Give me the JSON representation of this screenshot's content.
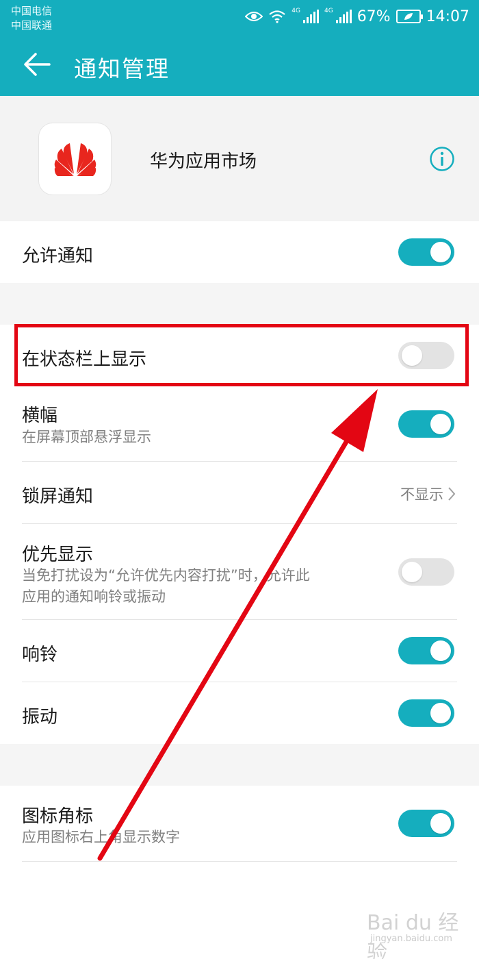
{
  "status_bar": {
    "carrier_1": "中国电信",
    "carrier_2": "中国联通",
    "network_1": "4G",
    "network_2": "4G",
    "battery_percent": "67%",
    "time": "14:07"
  },
  "header": {
    "title": "通知管理",
    "background": "#15aebe"
  },
  "app": {
    "name": "华为应用市场",
    "icon": "huawei-logo-icon"
  },
  "settings": {
    "allow_notifications": {
      "label": "允许通知",
      "enabled": true
    },
    "status_bar": {
      "label": "在状态栏上显示",
      "enabled": false
    },
    "banner": {
      "label": "横幅",
      "description": "在屏幕顶部悬浮显示",
      "enabled": true
    },
    "lock_screen": {
      "label": "锁屏通知",
      "value": "不显示"
    },
    "priority": {
      "label": "优先显示",
      "description_line_1": "当免打扰设为“允许优先内容打扰”时，允许此",
      "description_line_2": "应用的通知响铃或振动",
      "enabled": false
    },
    "ringtone": {
      "label": "响铃",
      "enabled": true
    },
    "vibration": {
      "label": "振动",
      "enabled": true
    },
    "badge": {
      "label": "图标角标",
      "description": "应用图标右上角显示数字",
      "enabled": true
    }
  },
  "annotation": {
    "highlight_color": "#e30613"
  },
  "watermark": {
    "text": "Bai du 经验",
    "subtext": "jingyan.baidu.com"
  },
  "colors": {
    "accent": "#15aebe",
    "toggle_off": "#e3e3e3",
    "annotation": "#e30613"
  }
}
